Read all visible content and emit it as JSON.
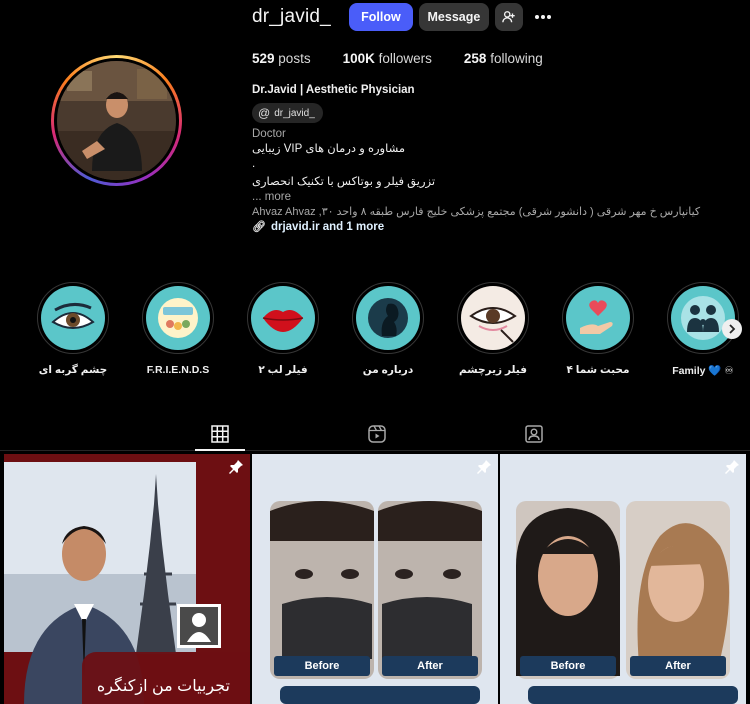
{
  "profile": {
    "username": "dr_javid_",
    "follow_label": "Follow",
    "message_label": "Message",
    "add_user_icon": "add-person-icon",
    "more_icon": "more-options-icon"
  },
  "stats": {
    "posts_num": "529",
    "posts_label": "posts",
    "followers_num": "100K",
    "followers_label": "followers",
    "following_num": "258",
    "following_label": "following"
  },
  "bio": {
    "name": "Dr.Javid | Aesthetic Physician",
    "threads_handle": "dr_javid_",
    "category": "Doctor",
    "line1": "مشاوره و درمان های VIP زیبایی",
    "line2": ".",
    "line3": "تزریق فیلر و بوتاکس با تکنیک انحصاری",
    "more": "... more",
    "address": "Ahvaz Ahvaz ,کیانپارس خ مهر شرقی ( دانشور شرقی) مجتمع پزشکی خلیج فارس طبقه ۸ واحد ۳۰",
    "link_text": "drjavid.ir and 1 more"
  },
  "highlights": [
    {
      "label": "چشم گربه ای",
      "icon": "cat-eye-icon"
    },
    {
      "label": "F.R.I.E.N.D.S",
      "icon": "friends-icon"
    },
    {
      "label": "فیلر لب ۲",
      "icon": "lips-icon"
    },
    {
      "label": "درباره من",
      "icon": "profile-silhouette-icon"
    },
    {
      "label": "فیلر زیرچشم",
      "icon": "under-eye-filler-icon"
    },
    {
      "label": "محبت شما ۴",
      "icon": "hand-heart-icon"
    },
    {
      "label": "Family 💙 ♾",
      "icon": "family-icon"
    }
  ],
  "tabs": [
    "posts-grid-icon",
    "reels-icon",
    "tagged-icon"
  ],
  "posts": [
    {
      "caption": "تجربیات من ازکنگره",
      "pinned": true
    },
    {
      "before": "Before",
      "after": "After",
      "pinned": true
    },
    {
      "before": "Before",
      "after": "After",
      "pinned": true
    }
  ],
  "colors": {
    "follow": "#4a5df9",
    "secondary_btn": "#363636",
    "post1_bg": "#6d0f12",
    "post_bg": "#dfe6ef"
  }
}
